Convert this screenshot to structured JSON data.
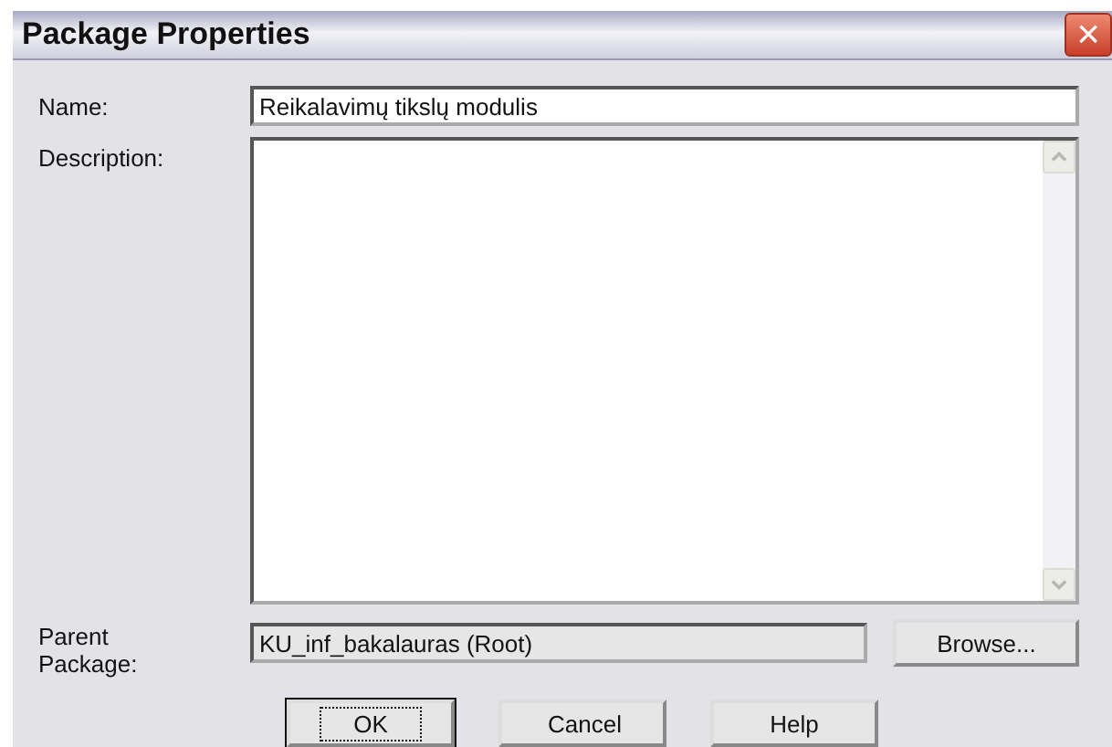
{
  "window": {
    "title": "Package Properties",
    "close": "×"
  },
  "fields": [
    {
      "label": "Name:",
      "value": "Reikalavimų tikslų modulis"
    },
    {
      "label": "Description:"
    },
    {
      "label": "Parent Package:",
      "value": "KU_inf_bakalauras (Root)",
      "disabled": true,
      "button": "Browse..."
    }
  ],
  "buttons": [
    {
      "label": "OK",
      "focused": true
    },
    {
      "label": "Cancel",
      "focused": false
    },
    {
      "label": "Help",
      "focused": false
    }
  ]
}
